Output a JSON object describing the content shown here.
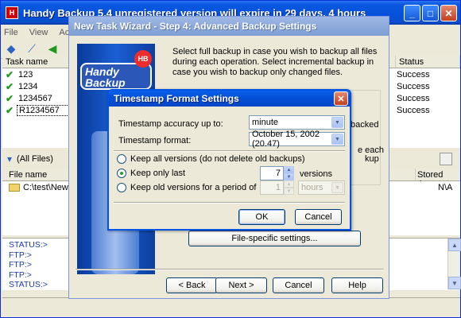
{
  "main_window": {
    "title": "Handy Backup 5.4 unregistered version will expire in 29 days, 4 hours",
    "menu": [
      "File",
      "View",
      "Action"
    ],
    "task_columns": [
      "Task name",
      "Status"
    ],
    "tasks": [
      {
        "name": "123",
        "status": "Success"
      },
      {
        "name": "1234",
        "status": "Success"
      },
      {
        "name": "1234567",
        "status": "Success"
      },
      {
        "name": "R1234567",
        "status": "Success"
      }
    ],
    "filter_label": "(All Files)",
    "file_columns": [
      "File name",
      "Stored time"
    ],
    "files": [
      {
        "name": "C:\\test\\New Fo",
        "stored": "N\\A"
      }
    ],
    "log_lines": [
      "STATUS:>",
      "FTP:>",
      "FTP:>",
      "FTP:>",
      "STATUS:>"
    ]
  },
  "wizard": {
    "title": "New Task Wizard - Step 4: Advanced Backup Settings",
    "logo_text": "Handy Backup",
    "logo_badge": "HB",
    "description": "Select full backup in case you wish to backup all files during each operation. Select incremental backup in case you wish to backup only changed files.",
    "side_text_1": "backed",
    "side_text_2": "e each",
    "side_text_3": "kup",
    "file_specific_label": "File-specific settings...",
    "back_label": "< Back",
    "next_label": "Next >",
    "cancel_label": "Cancel",
    "help_label": "Help"
  },
  "dialog": {
    "title": "Timestamp Format Settings",
    "accuracy_label": "Timestamp accuracy up to:",
    "accuracy_value": "minute",
    "format_label": "Timestamp format:",
    "format_value": "October 15, 2002 (20.47)",
    "option_all": "Keep all versions (do not delete old backups)",
    "option_last": "Keep only last",
    "option_period": "Keep old versions for a period of",
    "selected_option": "last",
    "last_count": "7",
    "last_unit": "versions",
    "period_count": "1",
    "period_unit": "hours",
    "ok_label": "OK",
    "cancel_label": "Cancel"
  },
  "colors": {
    "title_blue": "#0550db",
    "success_green": "#1f9a1f",
    "log_blue": "#1b3ba0"
  }
}
